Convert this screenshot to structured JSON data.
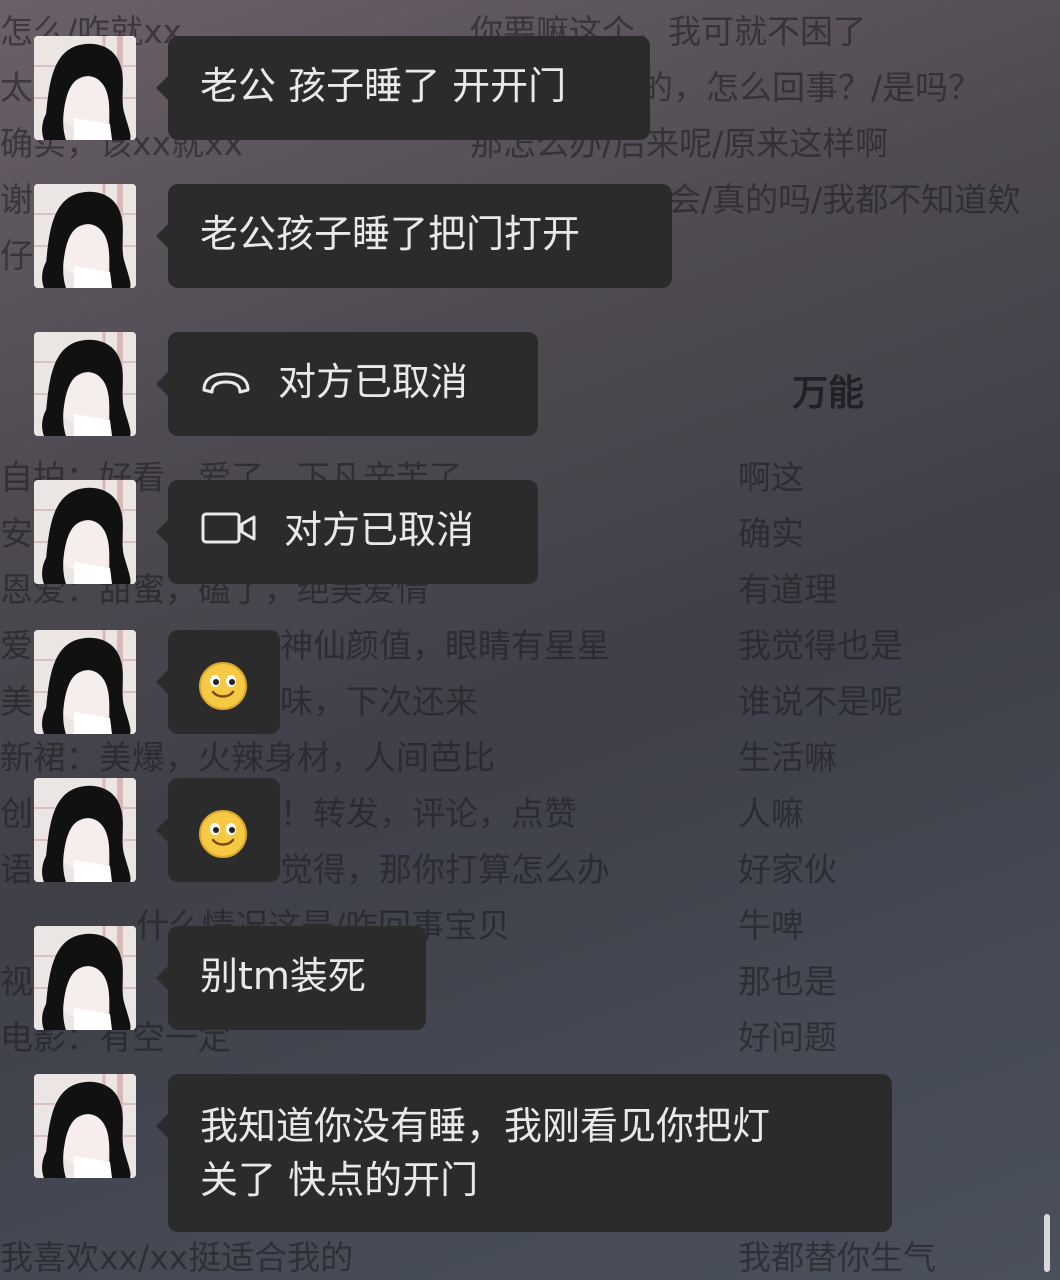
{
  "background_text": {
    "left_col": [
      "怎么/咋就xx",
      "太",
      "确实，该xx就xx",
      "谢",
      "仔",
      "自拍：好看，爱了，下凡辛苦了",
      "安",
      "恩爱：甜蜜，磕了，绝美爱情",
      "爱",
      "美",
      "新裙：美爆，火辣身材，人间芭比",
      "创",
      "语",
      "什么情况这是/咋回事宝贝",
      "视",
      "电影：有空一定",
      "我喜欢xx/xx挺适合我的"
    ],
    "mid_col": [
      "你要嘛这个，我可就不困了",
      "的，怎么回事？/是吗？",
      "那怎么办/后来呢/原来这样啊",
      "会/真的吗/我都不知道欸",
      "神仙颜值，眼睛有星星",
      "味，下次还来",
      "！转发，评论，点赞",
      "觉得，那你打算怎么办"
    ],
    "right_heading": "万能",
    "right_col": [
      "啊这",
      "确实",
      "有道理",
      "我觉得也是",
      "谁说不是呢",
      "生活嘛",
      "人嘛",
      "好家伙",
      "牛啤",
      "那也是",
      "好问题",
      "我都替你生气"
    ]
  },
  "messages": [
    {
      "type": "text",
      "text": "老公 孩子睡了 开开门"
    },
    {
      "type": "text",
      "text": "老公孩子睡了把门打开"
    },
    {
      "type": "call",
      "icon": "phone-hangup-icon",
      "text": "对方已取消"
    },
    {
      "type": "call",
      "icon": "video-call-icon",
      "text": "对方已取消"
    },
    {
      "type": "emoji",
      "icon": "smile-emoji-icon"
    },
    {
      "type": "emoji",
      "icon": "smile-emoji-icon"
    },
    {
      "type": "text",
      "text": "别tm装死"
    },
    {
      "type": "text",
      "line1": "我知道你没有睡，我刚看见你把灯",
      "line2": "关了 快点的开门"
    }
  ],
  "colors": {
    "bubble": "#2b2b2b",
    "bubble_text": "#e9e9e9",
    "emoji_yellow": "#f6c945"
  }
}
